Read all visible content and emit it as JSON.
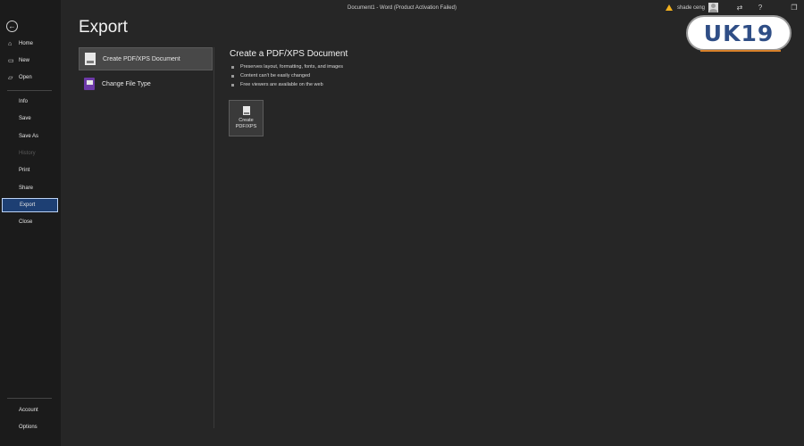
{
  "window": {
    "title": "Document1  -  Word (Product Activation Failed)",
    "user_name": "shade ceng",
    "controls": {
      "coauthor": "⇄",
      "help": "?",
      "restore": "❐"
    }
  },
  "logo": {
    "text": "UK19"
  },
  "sidebar": {
    "back_icon": "←",
    "items": [
      {
        "id": "home",
        "label": "Home",
        "icon": "⌂"
      },
      {
        "id": "new",
        "label": "New",
        "icon": "▭"
      },
      {
        "id": "open",
        "label": "Open",
        "icon": "▱"
      },
      {
        "id": "info",
        "label": "Info"
      },
      {
        "id": "save",
        "label": "Save"
      },
      {
        "id": "save-as",
        "label": "Save As"
      },
      {
        "id": "history",
        "label": "History"
      },
      {
        "id": "print",
        "label": "Print"
      },
      {
        "id": "share",
        "label": "Share"
      },
      {
        "id": "export",
        "label": "Export"
      },
      {
        "id": "close",
        "label": "Close"
      },
      {
        "id": "account",
        "label": "Account"
      },
      {
        "id": "options",
        "label": "Options"
      }
    ]
  },
  "main": {
    "title": "Export",
    "options": [
      {
        "label": "Create PDF/XPS Document",
        "selected": true
      },
      {
        "label": "Change File Type",
        "selected": false
      }
    ],
    "detail": {
      "title": "Create a PDF/XPS Document",
      "bullets": [
        "Preserves layout, formatting, fonts, and images",
        "Content can't be easily changed",
        "Free viewers are available on the web"
      ],
      "create_button": {
        "line1": "Create",
        "line2": "PDF/XPS"
      }
    }
  },
  "colors": {
    "accent": "#1d3f73",
    "background": "#262626",
    "sidebar": "#1b1b1b",
    "warning": "#f2b01e"
  }
}
